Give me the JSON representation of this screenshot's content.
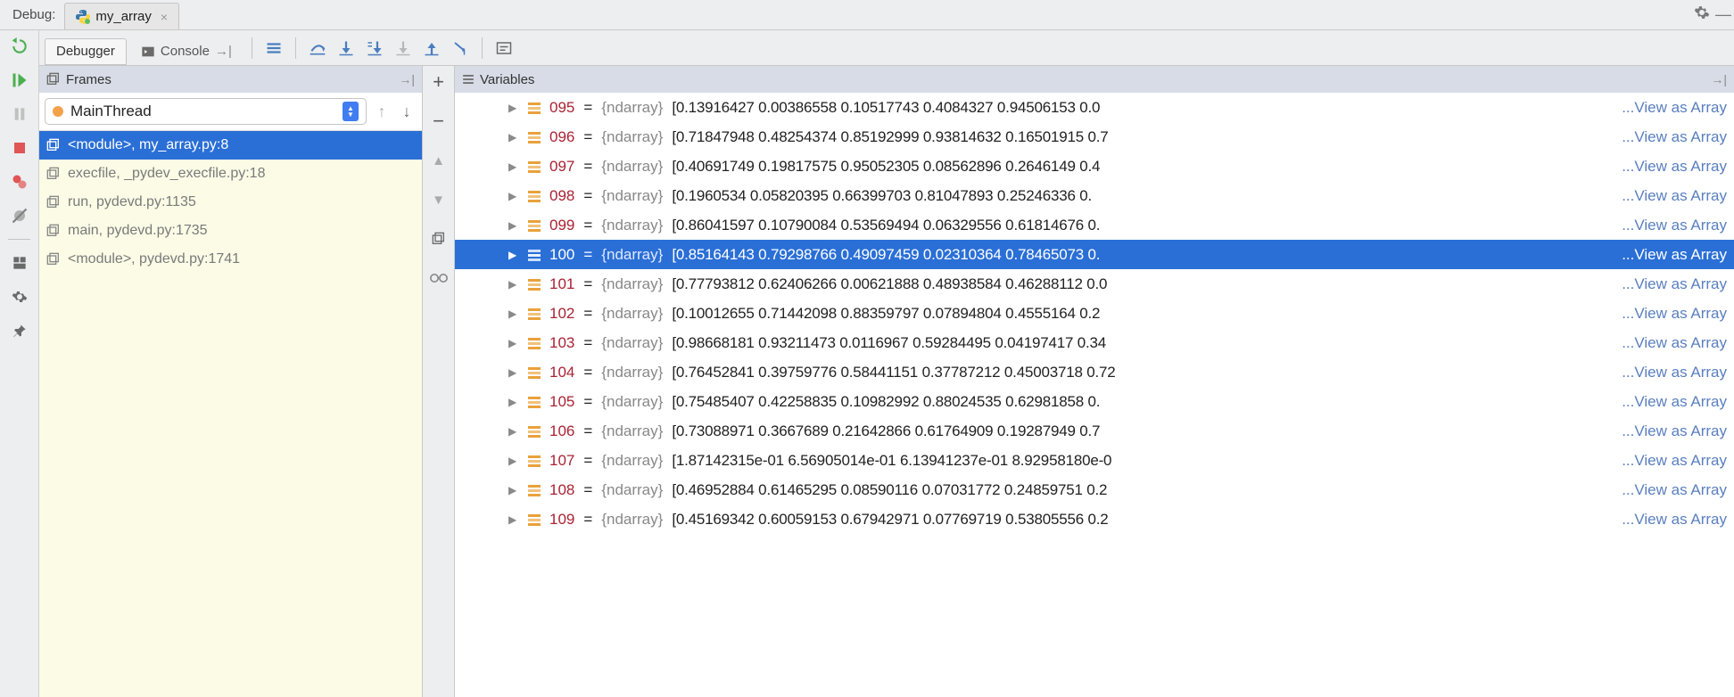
{
  "titlebar": {
    "label": "Debug:",
    "tab": "my_array"
  },
  "toolbar": {
    "tab_debugger": "Debugger",
    "tab_console": "Console"
  },
  "frames": {
    "header": "Frames",
    "thread": "MainThread",
    "items": [
      {
        "label": "<module>, my_array.py:8",
        "selected": true
      },
      {
        "label": "execfile, _pydev_execfile.py:18",
        "selected": false
      },
      {
        "label": "run, pydevd.py:1135",
        "selected": false
      },
      {
        "label": "main, pydevd.py:1735",
        "selected": false
      },
      {
        "label": "<module>, pydevd.py:1741",
        "selected": false
      }
    ]
  },
  "variables": {
    "header": "Variables",
    "view_link": "...View as Array",
    "type_label": "{ndarray}",
    "rows": [
      {
        "idx": "095",
        "vals": "[0.13916427 0.00386558 0.10517743 0.4084327  0.94506153 0.0",
        "selected": false
      },
      {
        "idx": "096",
        "vals": "[0.71847948 0.48254374 0.85192999 0.93814632 0.16501915 0.7",
        "selected": false
      },
      {
        "idx": "097",
        "vals": "[0.40691749 0.19817575 0.95052305 0.08562896 0.2646149  0.4",
        "selected": false
      },
      {
        "idx": "098",
        "vals": "[0.1960534  0.05820395 0.66399703 0.81047893 0.25246336 0.",
        "selected": false
      },
      {
        "idx": "099",
        "vals": "[0.86041597 0.10790084 0.53569494 0.06329556 0.61814676 0.",
        "selected": false
      },
      {
        "idx": "100",
        "vals": "[0.85164143 0.79298766 0.49097459 0.02310364 0.78465073 0.",
        "selected": true
      },
      {
        "idx": "101",
        "vals": "[0.77793812 0.62406266 0.00621888 0.48938584 0.46288112 0.0",
        "selected": false
      },
      {
        "idx": "102",
        "vals": "[0.10012655 0.71442098 0.88359797 0.07894804 0.4555164  0.2",
        "selected": false
      },
      {
        "idx": "103",
        "vals": "[0.98668181 0.93211473 0.0116967  0.59284495 0.04197417 0.34",
        "selected": false
      },
      {
        "idx": "104",
        "vals": "[0.76452841 0.39759776 0.58441151 0.37787212 0.45003718 0.72",
        "selected": false
      },
      {
        "idx": "105",
        "vals": "[0.75485407 0.42258835 0.10982992 0.88024535 0.62981858 0.",
        "selected": false
      },
      {
        "idx": "106",
        "vals": "[0.73088971 0.3667689  0.21642866 0.61764909 0.19287949 0.7",
        "selected": false
      },
      {
        "idx": "107",
        "vals": "[1.87142315e-01 6.56905014e-01 6.13941237e-01 8.92958180e-0",
        "selected": false
      },
      {
        "idx": "108",
        "vals": "[0.46952884 0.61465295 0.08590116 0.07031772 0.24859751 0.2",
        "selected": false
      },
      {
        "idx": "109",
        "vals": "[0.45169342 0.60059153 0.67942971 0.07769719 0.53805556 0.2",
        "selected": false
      }
    ]
  }
}
